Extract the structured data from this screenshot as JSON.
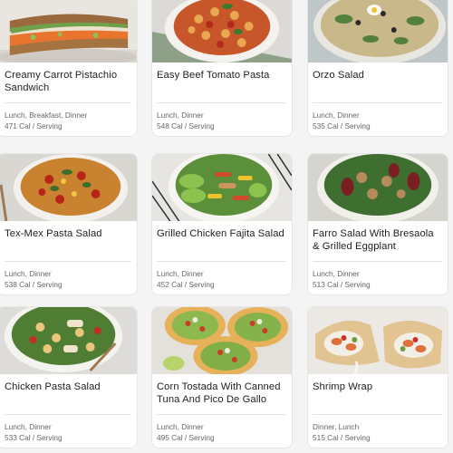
{
  "recipes": [
    {
      "title": "Creamy Carrot Pistachio Sandwich",
      "meals": "Lunch, Breakfast, Dinner",
      "calories": "471 Cal / Serving",
      "image_icon": "sandwich-photo"
    },
    {
      "title": "Easy Beef Tomato Pasta",
      "meals": "Lunch, Dinner",
      "calories": "548 Cal / Serving",
      "image_icon": "pasta-photo"
    },
    {
      "title": "Orzo Salad",
      "meals": "Lunch, Dinner",
      "calories": "535 Cal / Serving",
      "image_icon": "orzo-salad-photo"
    },
    {
      "title": "Tex-Mex Pasta Salad",
      "meals": "Lunch, Dinner",
      "calories": "538 Cal / Serving",
      "image_icon": "pasta-salad-photo"
    },
    {
      "title": "Grilled Chicken Fajita Salad",
      "meals": "Lunch, Dinner",
      "calories": "452 Cal / Serving",
      "image_icon": "fajita-salad-photo"
    },
    {
      "title": "Farro Salad With Bresaola & Grilled Eggplant",
      "meals": "Lunch, Dinner",
      "calories": "513 Cal / Serving",
      "image_icon": "farro-salad-photo"
    },
    {
      "title": "Chicken Pasta Salad",
      "meals": "Lunch, Dinner",
      "calories": "533 Cal / Serving",
      "image_icon": "chicken-pasta-photo"
    },
    {
      "title": "Corn Tostada With Canned Tuna And Pico De Gallo",
      "meals": "Lunch, Dinner",
      "calories": "495 Cal / Serving",
      "image_icon": "tostada-photo"
    },
    {
      "title": "Shrimp Wrap",
      "meals": "Dinner, Lunch",
      "calories": "515 Cal / Serving",
      "image_icon": "wrap-photo"
    }
  ]
}
